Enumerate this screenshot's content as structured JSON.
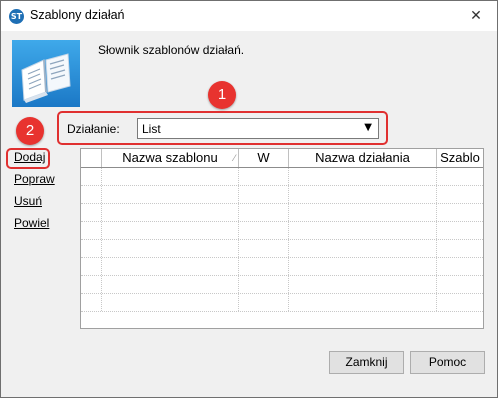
{
  "window": {
    "title": "Szablony działań",
    "app_icon_text": "ST",
    "close_glyph": "✕"
  },
  "header": {
    "description": "Słownik szablonów działań."
  },
  "action": {
    "label": "Działanie:",
    "selected": "List",
    "arrow": "▼"
  },
  "callouts": {
    "one": "1",
    "two": "2"
  },
  "sidebar": {
    "items": [
      {
        "label": "Dodaj"
      },
      {
        "label": "Popraw"
      },
      {
        "label": "Usuń"
      },
      {
        "label": "Powiel"
      }
    ]
  },
  "grid": {
    "columns": [
      {
        "label": ""
      },
      {
        "label": "Nazwa szablonu"
      },
      {
        "label": "W"
      },
      {
        "label": "Nazwa działania"
      },
      {
        "label": "Szablo"
      }
    ],
    "sort_glyph": "⁄",
    "empty_row_count": 8
  },
  "buttons": {
    "close": "Zamknij",
    "help": "Pomoc"
  },
  "colors": {
    "callout": "#e8332f",
    "frame": "#e03030",
    "icon_blue": "#1b78c6"
  }
}
